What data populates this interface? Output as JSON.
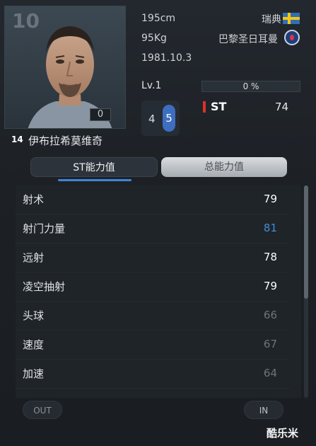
{
  "player": {
    "card_number": "10",
    "ovr_box": "0",
    "position_number": "14",
    "name": "伊布拉希莫维奇",
    "height": "195cm",
    "weight": "95Kg",
    "birth": "1981.10.3",
    "nation": "瑞典",
    "club": "巴黎圣日耳曼",
    "level": "Lv.1",
    "xp_percent_text": "0 %",
    "xp_fill": 0,
    "foot_weak": "4",
    "foot_strong": "5",
    "position": "ST",
    "position_rating": "74"
  },
  "tabs": {
    "st": "ST能力值",
    "total": "总能力值"
  },
  "stats": [
    {
      "label": "射术",
      "value": "79",
      "color": "#ffffff"
    },
    {
      "label": "射门力量",
      "value": "81",
      "color": "#3d8fd9"
    },
    {
      "label": "远射",
      "value": "78",
      "color": "#ffffff"
    },
    {
      "label": "凌空抽射",
      "value": "79",
      "color": "#ffffff"
    },
    {
      "label": "头球",
      "value": "66",
      "color": "#6c747b"
    },
    {
      "label": "速度",
      "value": "67",
      "color": "#6c747b"
    },
    {
      "label": "加速",
      "value": "64",
      "color": "#6c747b"
    }
  ],
  "buttons": {
    "out": "OUT",
    "in": "IN"
  },
  "watermark": "酷乐米"
}
